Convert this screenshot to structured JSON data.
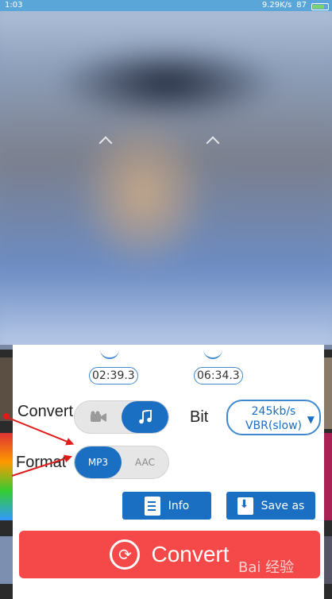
{
  "status_bar": {
    "time": "1:03",
    "network_speed": "9.29K/s",
    "battery": "87"
  },
  "trim": {
    "start_time": "02:39.3",
    "end_time": "06:34.3"
  },
  "convert_mode": {
    "label": "Convert",
    "options": [
      "video",
      "audio"
    ],
    "selected": "audio"
  },
  "format": {
    "label": "Format",
    "options": [
      "MP3",
      "AAC"
    ],
    "selected": "MP3"
  },
  "bitrate": {
    "label": "Bit",
    "value_line1": "245kb/s",
    "value_line2": "VBR(slow)"
  },
  "buttons": {
    "info": "Info",
    "save_as": "Save as",
    "convert": "Convert"
  },
  "watermark": "Bai 经验",
  "colors": {
    "primary": "#1a6fc2",
    "convert": "#f54848",
    "annotation_arrow": "#e01b1b"
  }
}
